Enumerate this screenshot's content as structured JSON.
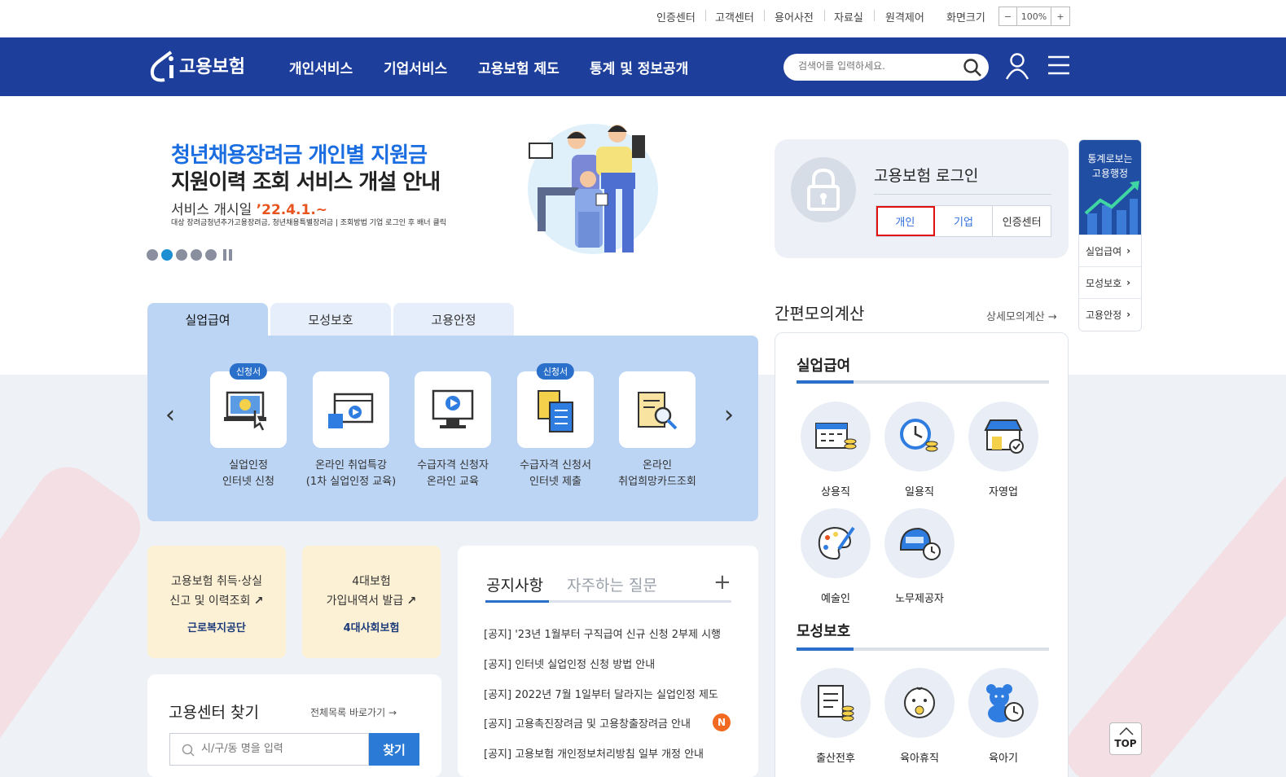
{
  "util": {
    "items": [
      "인증센터",
      "고객센터",
      "용어사전",
      "자료실",
      "원격제어",
      "화면크기"
    ],
    "zoom_minus": "−",
    "zoom_value": "100%",
    "zoom_plus": "+"
  },
  "nav": {
    "logo": "고용보험",
    "menus": [
      "개인서비스",
      "기업서비스",
      "고용보험 제도",
      "통계 및 정보공개"
    ],
    "search_placeholder": "검색어를 입력하세요."
  },
  "banner": {
    "line1": "청년채용장려금 개인별 지원금",
    "line2": "지원이력 조회 서비스 개설 안내",
    "date_label": "서비스 개시일 ",
    "date_value": "’22.4.1.~",
    "note": "대상 장려금청년추가고용장려금, 청년채용특별장려금 | 조회방법 기업 로그인 후 배너 클릭"
  },
  "login": {
    "title": "고용보험 로그인",
    "buttons": [
      "개인",
      "기업",
      "인증센터"
    ]
  },
  "side": {
    "top": "통계로보는 고용행정",
    "items": [
      "실업급여",
      "모성보호",
      "고용안정"
    ]
  },
  "tabs": [
    "실업급여",
    "모성보호",
    "고용안정"
  ],
  "services": [
    {
      "badge": "신청서",
      "l1": "실업인정",
      "l2": "인터넷 신청"
    },
    {
      "badge": "",
      "l1": "온라인 취업특강",
      "l2": "(1차 실업인정 교육)"
    },
    {
      "badge": "",
      "l1": "수급자격 신청자",
      "l2": "온라인 교육"
    },
    {
      "badge": "신청서",
      "l1": "수급자격 신청서",
      "l2": "인터넷 제출"
    },
    {
      "badge": "",
      "l1": "온라인",
      "l2": "취업희망카드조회"
    }
  ],
  "cards": [
    {
      "l1": "고용보험 취득·상실",
      "l2": "신고 및 이력조회",
      "org": "근로복지공단"
    },
    {
      "l1": "4대보험",
      "l2": "가입내역서 발급",
      "org": "4대사회보험"
    }
  ],
  "notice": {
    "tab1": "공지사항",
    "tab2": "자주하는 질문",
    "plus": "+",
    "badge": "N",
    "items": [
      "[공지] '23년 1월부터 구직급여 신규 신청 2부제 시행",
      "[공지] 인터넷 실업인정 신청 방법 안내",
      "[공지] 2022년 7월 1일부터 달라지는 실업인정 제도",
      "[공지] 고용촉진장려금 및 고용창출장려금 안내",
      "[공지] 고용보험 개인정보처리방침 일부 개정 안내"
    ]
  },
  "center": {
    "title": "고용센터 찾기",
    "link": "전체목록 바로가기",
    "placeholder": "시/구/동 명을 입력",
    "button": "찾기"
  },
  "calc": {
    "title": "간편모의계산",
    "link": "상세모의계산",
    "sec1": "실업급여",
    "sec2": "모성보호",
    "items1": [
      "상용직",
      "일용직",
      "자영업",
      "예술인",
      "노무제공자"
    ],
    "items2": [
      "출산전후",
      "육아휴직",
      "육아기"
    ]
  },
  "top": "TOP",
  "colors": {
    "nav": "#1d3e9a",
    "panel": "#bcd5f4",
    "accent": "#2a6fc9",
    "highlight": "#e01010"
  }
}
